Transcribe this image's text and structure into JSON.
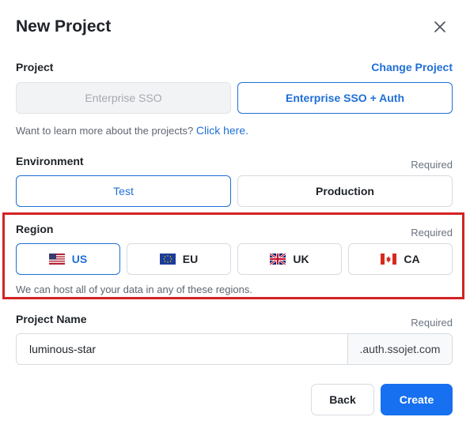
{
  "dialog": {
    "title": "New Project"
  },
  "project": {
    "label": "Project",
    "change_link": "Change Project",
    "options": [
      {
        "label": "Enterprise SSO",
        "state": "disabled"
      },
      {
        "label": "Enterprise SSO + Auth",
        "state": "selected"
      }
    ],
    "hint_text": "Want to learn more about the projects?",
    "hint_link": "Click here."
  },
  "environment": {
    "label": "Environment",
    "required": "Required",
    "options": [
      {
        "label": "Test",
        "state": "selected"
      },
      {
        "label": "Production",
        "state": "default"
      }
    ]
  },
  "region": {
    "label": "Region",
    "required": "Required",
    "options": [
      {
        "label": "US",
        "flag": "us-flag-icon",
        "state": "selected"
      },
      {
        "label": "EU",
        "flag": "eu-flag-icon",
        "state": "default"
      },
      {
        "label": "UK",
        "flag": "uk-flag-icon",
        "state": "default"
      },
      {
        "label": "CA",
        "flag": "ca-flag-icon",
        "state": "default"
      }
    ],
    "hint": "We can host all of your data in any of these regions.",
    "highlight_color": "#d32323"
  },
  "project_name": {
    "label": "Project Name",
    "required": "Required",
    "value": "luminous-star",
    "suffix": ".auth.ssojet.com"
  },
  "actions": {
    "back": "Back",
    "create": "Create"
  },
  "colors": {
    "accent": "#1670ef",
    "link": "#1f6fd6",
    "highlight": "#d32323"
  }
}
